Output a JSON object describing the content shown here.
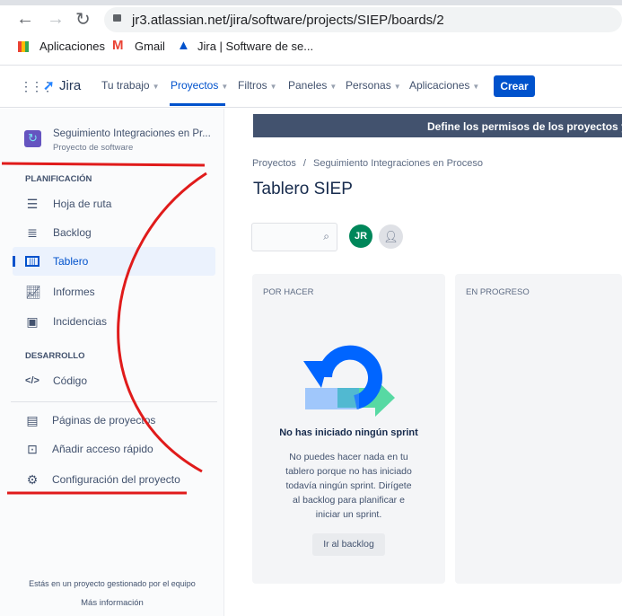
{
  "browser": {
    "url": "jr3.atlassian.net/jira/software/projects/SIEP/boards/2",
    "bookmarks": [
      "Aplicaciones",
      "Gmail",
      "Jira | Software de se..."
    ]
  },
  "nav": {
    "product": "Jira",
    "items": [
      "Tu trabajo",
      "Proyectos",
      "Filtros",
      "Paneles",
      "Personas",
      "Aplicaciones"
    ],
    "create": "Crear"
  },
  "sidebar": {
    "project_name": "Seguimiento Integraciones en Pr...",
    "project_type": "Proyecto de software",
    "section_planning": "PLANIFICACIÓN",
    "planning": [
      {
        "label": "Hoja de ruta",
        "icon": "roadmap-icon"
      },
      {
        "label": "Backlog",
        "icon": "backlog-icon"
      },
      {
        "label": "Tablero",
        "icon": "board-icon"
      },
      {
        "label": "Informes",
        "icon": "reports-icon"
      },
      {
        "label": "Incidencias",
        "icon": "issues-icon"
      }
    ],
    "section_dev": "DESARROLLO",
    "code": "Código",
    "pages": "Páginas de proyectos",
    "shortcut": "Añadir acceso rápido",
    "settings": "Configuración del proyecto",
    "footer": "Estás en un proyecto gestionado por el equipo",
    "more": "Más información"
  },
  "main": {
    "banner": "Define los permisos de los proyectos y las i",
    "breadcrumb": [
      "Proyectos",
      "Seguimiento Integraciones en Proceso"
    ],
    "title": "Tablero SIEP",
    "avatar": "JR",
    "columns": [
      "POR HACER",
      "EN PROGRESO"
    ],
    "empty_title": "No has iniciado ningún sprint",
    "empty_text": [
      "No puedes hacer nada en tu",
      "tablero porque no has iniciado",
      "todavía ningún sprint. Dirígete",
      "al backlog para planificar e",
      "iniciar un sprint."
    ],
    "empty_button": "Ir al backlog"
  },
  "colors": {
    "primary": "#0052cc",
    "banner": "#42526e",
    "avatar": "#00875a",
    "annotation": "#e01b1b"
  }
}
